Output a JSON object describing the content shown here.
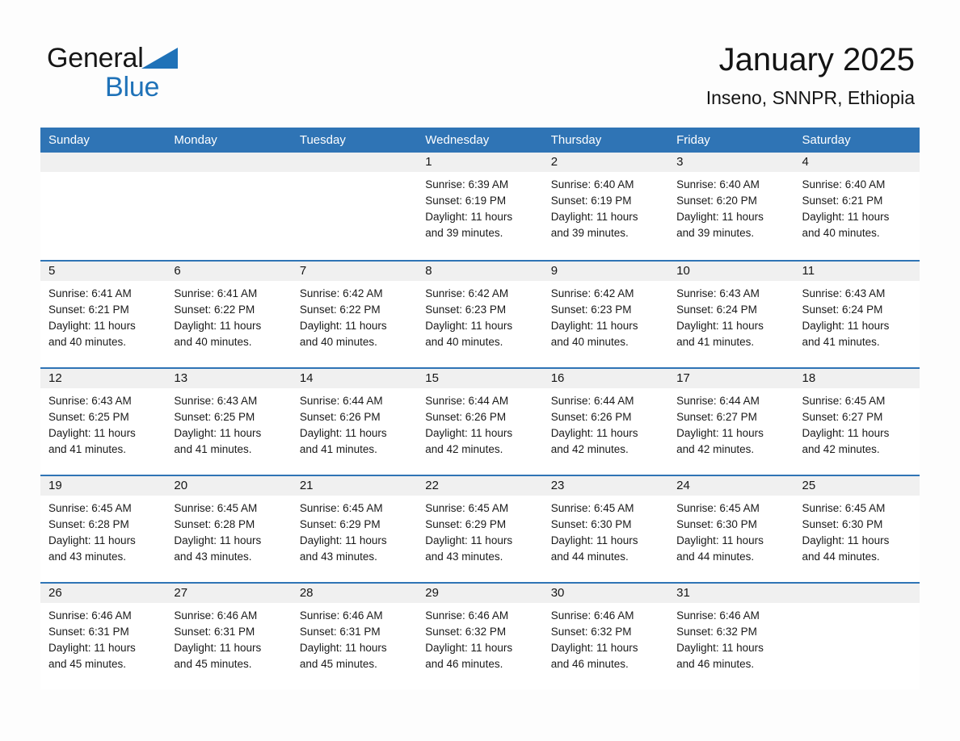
{
  "brand": {
    "word1": "General",
    "word2": "Blue",
    "triangle_color": "#1f72b8"
  },
  "header": {
    "title": "January 2025",
    "subtitle": "Inseno, SNNPR, Ethiopia"
  },
  "theme": {
    "header_blue": "#2f74b5",
    "daynum_band": "#f0f0f0",
    "text": "#1a1a1a"
  },
  "calendar": {
    "weekday_headers": [
      "Sunday",
      "Monday",
      "Tuesday",
      "Wednesday",
      "Thursday",
      "Friday",
      "Saturday"
    ],
    "weeks": [
      [
        {
          "day": "",
          "sunrise": "",
          "sunset": "",
          "daylight1": "",
          "daylight2": ""
        },
        {
          "day": "",
          "sunrise": "",
          "sunset": "",
          "daylight1": "",
          "daylight2": ""
        },
        {
          "day": "",
          "sunrise": "",
          "sunset": "",
          "daylight1": "",
          "daylight2": ""
        },
        {
          "day": "1",
          "sunrise": "Sunrise: 6:39 AM",
          "sunset": "Sunset: 6:19 PM",
          "daylight1": "Daylight: 11 hours",
          "daylight2": "and 39 minutes."
        },
        {
          "day": "2",
          "sunrise": "Sunrise: 6:40 AM",
          "sunset": "Sunset: 6:19 PM",
          "daylight1": "Daylight: 11 hours",
          "daylight2": "and 39 minutes."
        },
        {
          "day": "3",
          "sunrise": "Sunrise: 6:40 AM",
          "sunset": "Sunset: 6:20 PM",
          "daylight1": "Daylight: 11 hours",
          "daylight2": "and 39 minutes."
        },
        {
          "day": "4",
          "sunrise": "Sunrise: 6:40 AM",
          "sunset": "Sunset: 6:21 PM",
          "daylight1": "Daylight: 11 hours",
          "daylight2": "and 40 minutes."
        }
      ],
      [
        {
          "day": "5",
          "sunrise": "Sunrise: 6:41 AM",
          "sunset": "Sunset: 6:21 PM",
          "daylight1": "Daylight: 11 hours",
          "daylight2": "and 40 minutes."
        },
        {
          "day": "6",
          "sunrise": "Sunrise: 6:41 AM",
          "sunset": "Sunset: 6:22 PM",
          "daylight1": "Daylight: 11 hours",
          "daylight2": "and 40 minutes."
        },
        {
          "day": "7",
          "sunrise": "Sunrise: 6:42 AM",
          "sunset": "Sunset: 6:22 PM",
          "daylight1": "Daylight: 11 hours",
          "daylight2": "and 40 minutes."
        },
        {
          "day": "8",
          "sunrise": "Sunrise: 6:42 AM",
          "sunset": "Sunset: 6:23 PM",
          "daylight1": "Daylight: 11 hours",
          "daylight2": "and 40 minutes."
        },
        {
          "day": "9",
          "sunrise": "Sunrise: 6:42 AM",
          "sunset": "Sunset: 6:23 PM",
          "daylight1": "Daylight: 11 hours",
          "daylight2": "and 40 minutes."
        },
        {
          "day": "10",
          "sunrise": "Sunrise: 6:43 AM",
          "sunset": "Sunset: 6:24 PM",
          "daylight1": "Daylight: 11 hours",
          "daylight2": "and 41 minutes."
        },
        {
          "day": "11",
          "sunrise": "Sunrise: 6:43 AM",
          "sunset": "Sunset: 6:24 PM",
          "daylight1": "Daylight: 11 hours",
          "daylight2": "and 41 minutes."
        }
      ],
      [
        {
          "day": "12",
          "sunrise": "Sunrise: 6:43 AM",
          "sunset": "Sunset: 6:25 PM",
          "daylight1": "Daylight: 11 hours",
          "daylight2": "and 41 minutes."
        },
        {
          "day": "13",
          "sunrise": "Sunrise: 6:43 AM",
          "sunset": "Sunset: 6:25 PM",
          "daylight1": "Daylight: 11 hours",
          "daylight2": "and 41 minutes."
        },
        {
          "day": "14",
          "sunrise": "Sunrise: 6:44 AM",
          "sunset": "Sunset: 6:26 PM",
          "daylight1": "Daylight: 11 hours",
          "daylight2": "and 41 minutes."
        },
        {
          "day": "15",
          "sunrise": "Sunrise: 6:44 AM",
          "sunset": "Sunset: 6:26 PM",
          "daylight1": "Daylight: 11 hours",
          "daylight2": "and 42 minutes."
        },
        {
          "day": "16",
          "sunrise": "Sunrise: 6:44 AM",
          "sunset": "Sunset: 6:26 PM",
          "daylight1": "Daylight: 11 hours",
          "daylight2": "and 42 minutes."
        },
        {
          "day": "17",
          "sunrise": "Sunrise: 6:44 AM",
          "sunset": "Sunset: 6:27 PM",
          "daylight1": "Daylight: 11 hours",
          "daylight2": "and 42 minutes."
        },
        {
          "day": "18",
          "sunrise": "Sunrise: 6:45 AM",
          "sunset": "Sunset: 6:27 PM",
          "daylight1": "Daylight: 11 hours",
          "daylight2": "and 42 minutes."
        }
      ],
      [
        {
          "day": "19",
          "sunrise": "Sunrise: 6:45 AM",
          "sunset": "Sunset: 6:28 PM",
          "daylight1": "Daylight: 11 hours",
          "daylight2": "and 43 minutes."
        },
        {
          "day": "20",
          "sunrise": "Sunrise: 6:45 AM",
          "sunset": "Sunset: 6:28 PM",
          "daylight1": "Daylight: 11 hours",
          "daylight2": "and 43 minutes."
        },
        {
          "day": "21",
          "sunrise": "Sunrise: 6:45 AM",
          "sunset": "Sunset: 6:29 PM",
          "daylight1": "Daylight: 11 hours",
          "daylight2": "and 43 minutes."
        },
        {
          "day": "22",
          "sunrise": "Sunrise: 6:45 AM",
          "sunset": "Sunset: 6:29 PM",
          "daylight1": "Daylight: 11 hours",
          "daylight2": "and 43 minutes."
        },
        {
          "day": "23",
          "sunrise": "Sunrise: 6:45 AM",
          "sunset": "Sunset: 6:30 PM",
          "daylight1": "Daylight: 11 hours",
          "daylight2": "and 44 minutes."
        },
        {
          "day": "24",
          "sunrise": "Sunrise: 6:45 AM",
          "sunset": "Sunset: 6:30 PM",
          "daylight1": "Daylight: 11 hours",
          "daylight2": "and 44 minutes."
        },
        {
          "day": "25",
          "sunrise": "Sunrise: 6:45 AM",
          "sunset": "Sunset: 6:30 PM",
          "daylight1": "Daylight: 11 hours",
          "daylight2": "and 44 minutes."
        }
      ],
      [
        {
          "day": "26",
          "sunrise": "Sunrise: 6:46 AM",
          "sunset": "Sunset: 6:31 PM",
          "daylight1": "Daylight: 11 hours",
          "daylight2": "and 45 minutes."
        },
        {
          "day": "27",
          "sunrise": "Sunrise: 6:46 AM",
          "sunset": "Sunset: 6:31 PM",
          "daylight1": "Daylight: 11 hours",
          "daylight2": "and 45 minutes."
        },
        {
          "day": "28",
          "sunrise": "Sunrise: 6:46 AM",
          "sunset": "Sunset: 6:31 PM",
          "daylight1": "Daylight: 11 hours",
          "daylight2": "and 45 minutes."
        },
        {
          "day": "29",
          "sunrise": "Sunrise: 6:46 AM",
          "sunset": "Sunset: 6:32 PM",
          "daylight1": "Daylight: 11 hours",
          "daylight2": "and 46 minutes."
        },
        {
          "day": "30",
          "sunrise": "Sunrise: 6:46 AM",
          "sunset": "Sunset: 6:32 PM",
          "daylight1": "Daylight: 11 hours",
          "daylight2": "and 46 minutes."
        },
        {
          "day": "31",
          "sunrise": "Sunrise: 6:46 AM",
          "sunset": "Sunset: 6:32 PM",
          "daylight1": "Daylight: 11 hours",
          "daylight2": "and 46 minutes."
        },
        {
          "day": "",
          "sunrise": "",
          "sunset": "",
          "daylight1": "",
          "daylight2": ""
        }
      ]
    ]
  }
}
